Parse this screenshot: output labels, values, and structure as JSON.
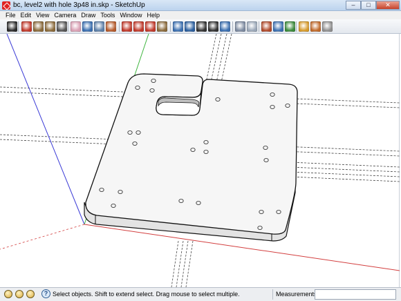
{
  "window": {
    "title": "bc, level2 with hole 3p48 in.skp - SketchUp",
    "min_glyph": "–",
    "max_glyph": "□",
    "close_glyph": "✕"
  },
  "menu": [
    "File",
    "Edit",
    "View",
    "Camera",
    "Draw",
    "Tools",
    "Window",
    "Help"
  ],
  "toolbar": {
    "tools": [
      {
        "name": "select-tool-icon",
        "color": "#2b2b2b"
      },
      {
        "name": "pencil-tool-icon",
        "color": "#c0392b"
      },
      {
        "name": "rectangle-tool-icon",
        "color": "#8a6a3b"
      },
      {
        "name": "circle-tool-icon",
        "color": "#8a6a3b"
      },
      {
        "name": "arc-tool-icon",
        "color": "#555555"
      },
      {
        "name": "eraser-tool-icon",
        "color": "#d9a0b4"
      },
      {
        "name": "paint-bucket-tool-icon",
        "color": "#3b6fb0"
      },
      {
        "name": "component-tool-icon",
        "color": "#5c7fa8"
      },
      {
        "name": "push-pull-tool-icon",
        "color": "#b55a2b"
      },
      {
        "name": "move-tool-icon",
        "color": "#c0392b"
      },
      {
        "name": "rotate-tool-icon",
        "color": "#c0392b"
      },
      {
        "name": "follow-me-tool-icon",
        "color": "#c0392b"
      },
      {
        "name": "offset-tool-icon",
        "color": "#8a6a3b"
      },
      {
        "name": "orbit-tool-icon",
        "color": "#3b6fb0"
      },
      {
        "name": "pan-tool-icon",
        "color": "#2c5f9e"
      },
      {
        "name": "zoom-tool-icon",
        "color": "#333333"
      },
      {
        "name": "zoom-window-tool-icon",
        "color": "#333333"
      },
      {
        "name": "zoom-extents-tool-icon",
        "color": "#3b6fb0"
      },
      {
        "name": "scenes-tool-icon",
        "color": "#7c8aa0"
      },
      {
        "name": "view-iso-icon",
        "color": "#9aa7b8"
      },
      {
        "name": "3d-warehouse-icon",
        "color": "#b04a2b"
      },
      {
        "name": "share-model-icon",
        "color": "#3b6fb0"
      },
      {
        "name": "get-models-icon",
        "color": "#3b8a3b"
      },
      {
        "name": "components-icon",
        "color": "#d69a2b"
      },
      {
        "name": "materials-icon",
        "color": "#c06a2b"
      },
      {
        "name": "styles-icon",
        "color": "#8f8f8f"
      }
    ]
  },
  "status": {
    "help_glyph": "?",
    "text": "Select objects. Shift to extend select. Drag mouse to select multiple.",
    "measurements_label": "Measurements",
    "measurements_value": ""
  },
  "colors": {
    "x_axis": "#d23c3c",
    "y_axis": "#3fb53f",
    "z_axis": "#3a3ad6",
    "plate_top": "#f6f6f6",
    "plate_side": "#e3e3e3",
    "edge": "#111111"
  }
}
